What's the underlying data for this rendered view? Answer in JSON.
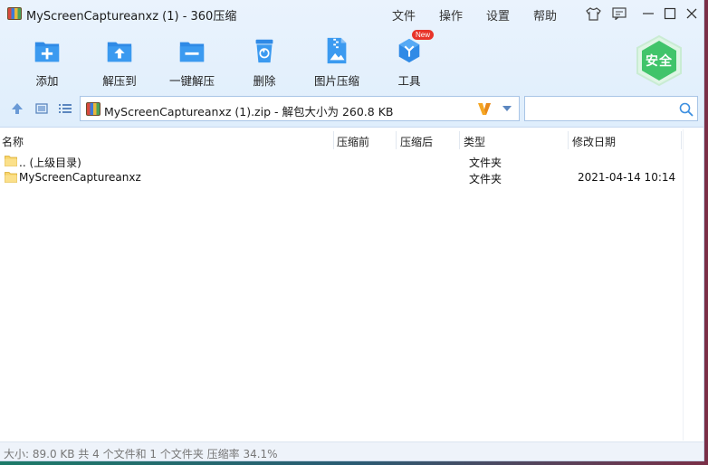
{
  "window": {
    "title": "MyScreenCaptureanxz (1) - 360压缩"
  },
  "menu": [
    "文件",
    "操作",
    "设置",
    "帮助"
  ],
  "toolbar": {
    "items": [
      {
        "label": "添加",
        "icon": "add-box-icon"
      },
      {
        "label": "解压到",
        "icon": "extract-to-icon"
      },
      {
        "label": "一键解压",
        "icon": "one-click-extract-icon"
      },
      {
        "label": "删除",
        "icon": "trash-can-icon"
      },
      {
        "label": "图片压缩",
        "icon": "image-compress-icon"
      },
      {
        "label": "工具",
        "icon": "tools-icon"
      }
    ],
    "new_badge": "New",
    "safe_badge": "安全"
  },
  "address": {
    "path": "MyScreenCaptureanxz (1).zip - 解包大小为 260.8 KB"
  },
  "search": {
    "value": "",
    "placeholder": ""
  },
  "columns": [
    "名称",
    "压缩前",
    "压缩后",
    "类型",
    "修改日期"
  ],
  "rows": [
    {
      "name": ".. (上级目录)",
      "before": "",
      "after": "",
      "type": "文件夹",
      "date": ""
    },
    {
      "name": "MyScreenCaptureanxz",
      "before": "",
      "after": "",
      "type": "文件夹",
      "date": "2021-04-14 10:14"
    }
  ],
  "status": "大小: 89.0 KB 共 4 个文件和 1 个文件夹 压缩率 34.1%",
  "colors": {
    "accent_blue": "#2f8ae6",
    "chrome_bg": "#e3effc",
    "safe_green": "#41c46a",
    "badge_red": "#e8342a"
  }
}
